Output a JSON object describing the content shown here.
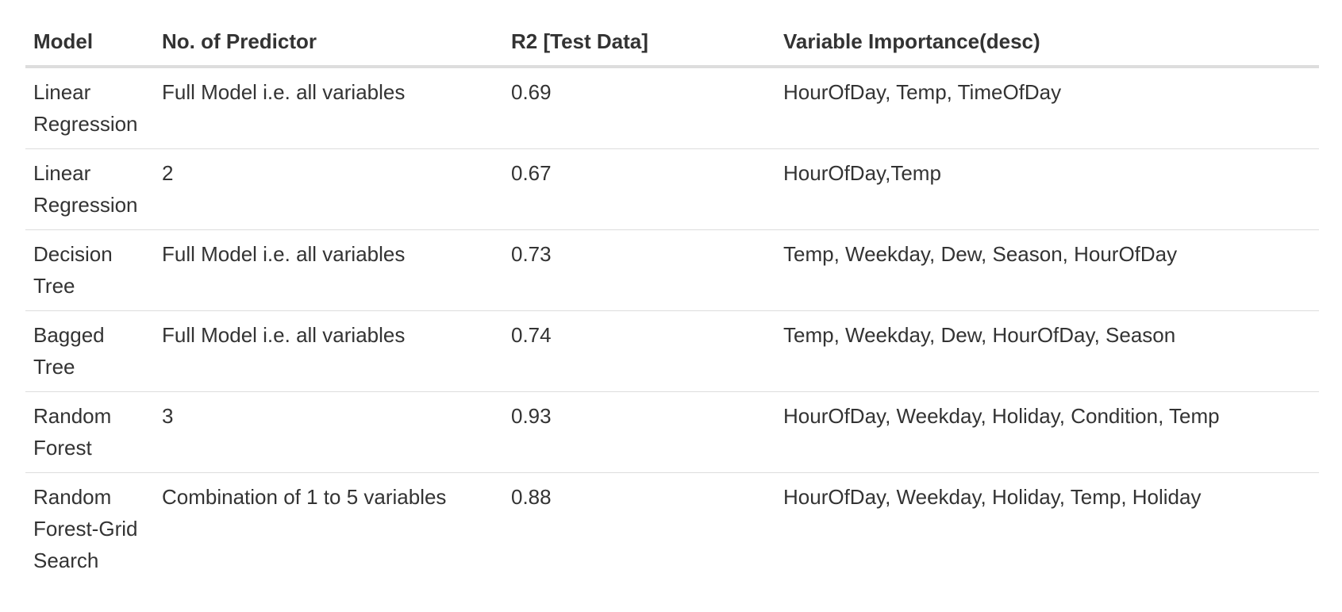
{
  "table": {
    "headers": {
      "model": "Model",
      "predictors": "No. of Predictor",
      "r2": "R2 [Test Data]",
      "importance": "Variable Importance(desc)"
    },
    "rows": [
      {
        "model": "Linear Regression",
        "predictors": "Full Model i.e. all variables",
        "r2": "0.69",
        "importance": "HourOfDay, Temp, TimeOfDay"
      },
      {
        "model": "Linear Regression",
        "predictors": "2",
        "r2": "0.67",
        "importance": "HourOfDay,Temp"
      },
      {
        "model": "Decision Tree",
        "predictors": "Full Model i.e. all variables",
        "r2": "0.73",
        "importance": "Temp, Weekday, Dew, Season, HourOfDay"
      },
      {
        "model": "Bagged Tree",
        "predictors": "Full Model i.e. all variables",
        "r2": "0.74",
        "importance": "Temp, Weekday, Dew, HourOfDay, Season"
      },
      {
        "model": "Random Forest",
        "predictors": "3",
        "r2": "0.93",
        "importance": "HourOfDay, Weekday, Holiday, Condition, Temp"
      },
      {
        "model": "Random Forest-Grid Search",
        "predictors": "Combination of 1 to 5 variables",
        "r2": "0.88",
        "importance": "HourOfDay, Weekday, Holiday, Temp, Holiday"
      }
    ]
  }
}
